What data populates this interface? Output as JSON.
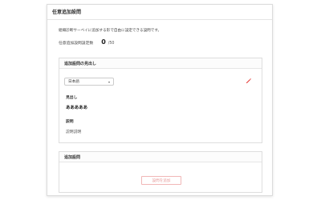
{
  "panel": {
    "title": "任意追加設問",
    "description": "組織診断サーベイに追加する形で自由に設定できる設問です。",
    "count_label": "任意追加設問設定数",
    "count_value": "0",
    "count_max": "/50"
  },
  "question_card": {
    "title": "追加設問の見出し",
    "language_select": "日本語",
    "heading_label": "見出し",
    "heading_value": "あああああ",
    "description_label": "説明",
    "description_value": "説明説明",
    "edit_icon_color": "#e53935"
  },
  "add_card": {
    "title": "追加設問",
    "add_button_label": "設問を追加",
    "button_color": "#e79a9a"
  }
}
